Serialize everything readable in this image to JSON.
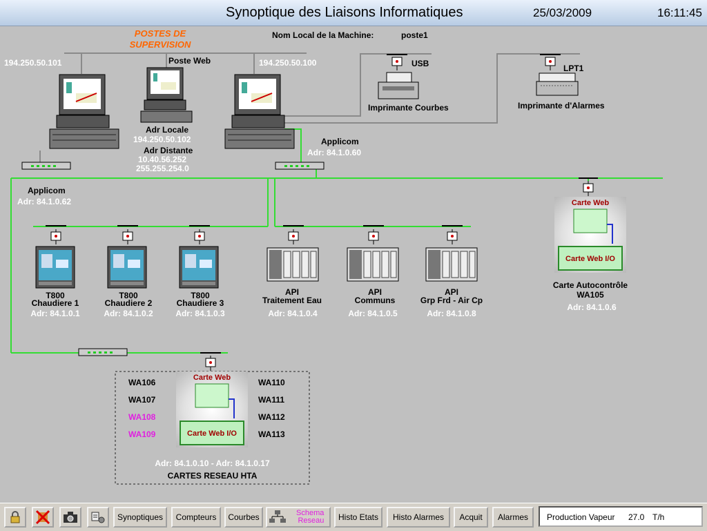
{
  "header": {
    "title": "Synoptique des Liaisons Informatiques",
    "date": "25/03/2009",
    "time": "16:11:45"
  },
  "supervision": {
    "title_line1": "POSTES DE",
    "title_line2": "SUPERVISION",
    "machine_label": "Nom Local de la Machine:",
    "machine_name": "poste1"
  },
  "workstations": {
    "left_ip": "194.250.50.101",
    "web_label": "Poste Web",
    "web_adr_locale_label": "Adr Locale",
    "web_adr_locale": "194.250.50.102",
    "web_adr_distante_label": "Adr Distante",
    "web_adr_distante": "10.40.56.252",
    "web_mask": "255.255.254.0",
    "right_ip": "194.250.50.100"
  },
  "printers": {
    "usb_label": "USB",
    "curves_label": "Imprimante Courbes",
    "lpt_label": "LPT1",
    "alarms_label": "Imprimante d'Alarmes"
  },
  "applicom_right": {
    "name": "Applicom",
    "adr": "Adr: 84.1.0.60"
  },
  "applicom_left": {
    "name": "Applicom",
    "adr": "Adr: 84.1.0.62"
  },
  "devices": [
    {
      "l1": "T800",
      "l2": "Chaudiere 1",
      "adr": "Adr: 84.1.0.1"
    },
    {
      "l1": "T800",
      "l2": "Chaudiere 2",
      "adr": "Adr: 84.1.0.2"
    },
    {
      "l1": "T800",
      "l2": "Chaudiere 3",
      "adr": "Adr: 84.1.0.3"
    },
    {
      "l1": "API",
      "l2": "Traitement Eau",
      "adr": "Adr: 84.1.0.4"
    },
    {
      "l1": "API",
      "l2": "Communs",
      "adr": "Adr: 84.1.0.5"
    },
    {
      "l1": "API",
      "l2": "Grp Frd - Air Cp",
      "adr": "Adr: 84.1.0.8"
    }
  ],
  "autocontrol": {
    "web_label": "Carte Web",
    "io_label": "Carte Web I/O",
    "name_line1": "Carte Autocontrôle",
    "name_line2": "WA105",
    "adr": "Adr: 84.1.0.6"
  },
  "hta": {
    "web_label": "Carte Web",
    "io_label": "Carte Web I/O",
    "left": [
      "WA106",
      "WA107",
      "WA108",
      "WA109"
    ],
    "right": [
      "WA110",
      "WA111",
      "WA112",
      "WA113"
    ],
    "adr": "Adr: 84.1.0.10 - Adr: 84.1.0.17",
    "title": "CARTES RESEAU HTA",
    "highlight_color": "#e020e0"
  },
  "colors": {
    "network": "#33dd33",
    "link": "#8a8a8a",
    "orange": "#ff6600",
    "card_red": "#a00000"
  },
  "toolbar": {
    "synoptiques": "Synoptiques",
    "compteurs": "Compteurs",
    "courbes": "Courbes",
    "schema_line1": "Schema",
    "schema_line2": "Reseau",
    "histo_etats": "Histo Etats",
    "histo_alarmes": "Histo Alarmes",
    "acquit": "Acquit",
    "alarmes": "Alarmes"
  },
  "status": {
    "label": "Production Vapeur",
    "value": "27.0",
    "unit": "T/h"
  }
}
